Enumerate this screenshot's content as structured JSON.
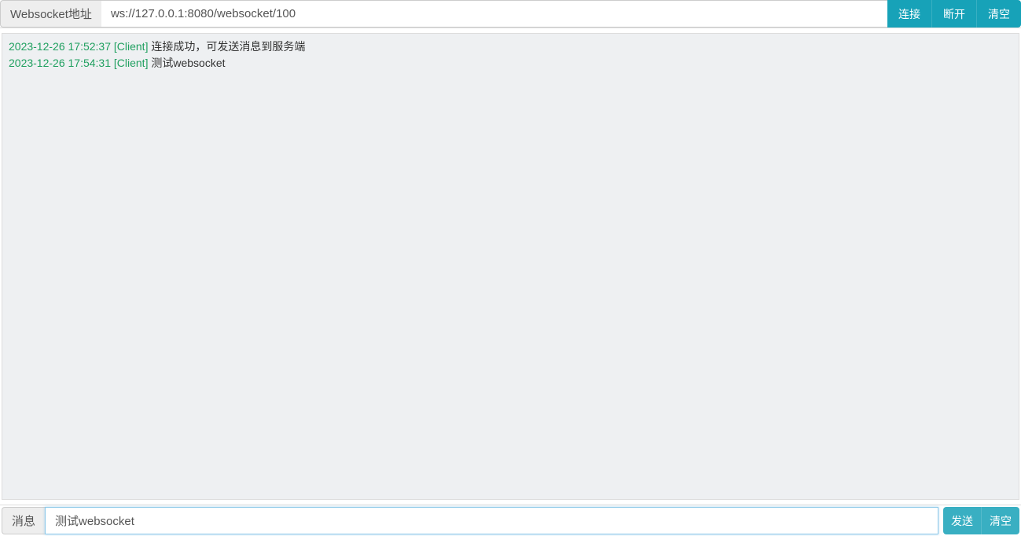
{
  "topbar": {
    "address_label": "Websocket地址",
    "address_value": "ws://127.0.0.1:8080/websocket/100",
    "connect_label": "连接",
    "disconnect_label": "断开",
    "clear_label": "清空"
  },
  "logs": [
    {
      "time": "2023-12-26 17:52:37",
      "source": "[Client]",
      "msg": "连接成功，可发送消息到服务端"
    },
    {
      "time": "2023-12-26 17:54:31",
      "source": "[Client]",
      "msg": "测试websocket"
    }
  ],
  "bottombar": {
    "msg_label": "消息",
    "msg_value": "测试websocket",
    "send_label": "发送",
    "clear_label": "清空"
  }
}
